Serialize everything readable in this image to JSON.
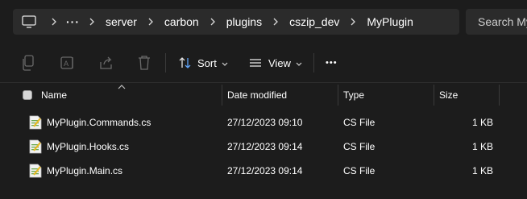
{
  "breadcrumb": {
    "items": [
      "server",
      "carbon",
      "plugins",
      "cszip_dev",
      "MyPlugin"
    ],
    "more": "···",
    "pc_icon": "monitor-icon",
    "separator_icon": "chevron-right-icon"
  },
  "search": {
    "placeholder": "Search My"
  },
  "toolbar": {
    "icons": [
      "copy-icon",
      "rename-icon",
      "share-icon",
      "delete-icon"
    ],
    "sort_label": "Sort",
    "view_label": "View",
    "more_label": "•••"
  },
  "columns": {
    "name": "Name",
    "date": "Date modified",
    "type": "Type",
    "size": "Size"
  },
  "files": [
    {
      "name": "MyPlugin.Commands.cs",
      "date": "27/12/2023 09:10",
      "type": "CS File",
      "size": "1 KB"
    },
    {
      "name": "MyPlugin.Hooks.cs",
      "date": "27/12/2023 09:14",
      "type": "CS File",
      "size": "1 KB"
    },
    {
      "name": "MyPlugin.Main.cs",
      "date": "27/12/2023 09:14",
      "type": "CS File",
      "size": "1 KB"
    }
  ],
  "colors": {
    "background": "#1c1c1c",
    "addressbar": "#2b2b2b",
    "text": "#ffffff"
  }
}
